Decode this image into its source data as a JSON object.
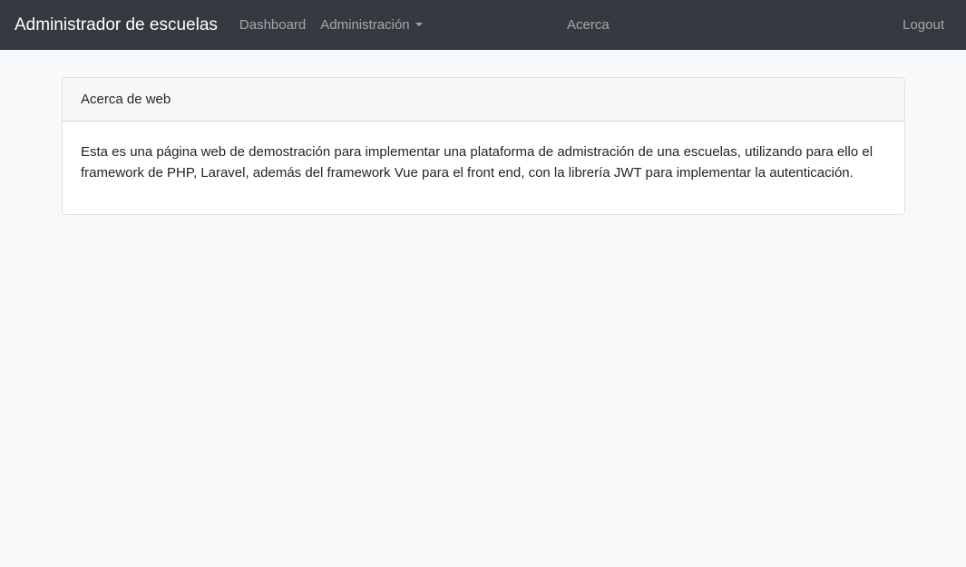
{
  "navbar": {
    "brand": "Administrador de escuelas",
    "links": {
      "dashboard": "Dashboard",
      "administracion": "Administración",
      "acerca": "Acerca",
      "logout": "Logout"
    },
    "background_color": "#343a40"
  },
  "card": {
    "header": "Acerca de web",
    "body": "Esta es una página web de demostración para implementar una plataforma de admistración de una escuelas, utilizando para ello el framework de PHP, Laravel, además del framework Vue para el front end, con la librería JWT para implementar la autenticación."
  },
  "icons": {
    "dropdown": "caret-down-icon"
  },
  "colors": {
    "page_background": "#f8f9fa",
    "card_header_background": "#f7f7f7",
    "text": "#212529"
  }
}
